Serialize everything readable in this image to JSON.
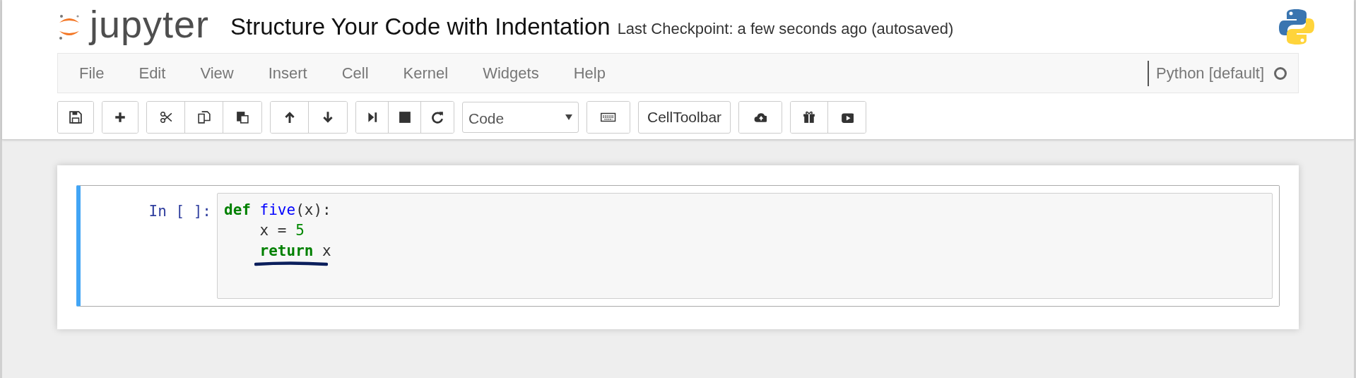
{
  "header": {
    "logo_text": "jupyter",
    "notebook_title": "Structure Your Code with Indentation",
    "checkpoint": "Last Checkpoint: a few seconds ago (autosaved)"
  },
  "menu": [
    "File",
    "Edit",
    "View",
    "Insert",
    "Cell",
    "Kernel",
    "Widgets",
    "Help"
  ],
  "kernel": {
    "name": "Python [default]",
    "busy": false
  },
  "toolbar": {
    "cell_type": "Code",
    "celltoolbar": "CellToolbar"
  },
  "cell": {
    "prompt": "In [ ]:",
    "selected": true,
    "lines": [
      {
        "indented": false,
        "tokens": [
          {
            "kind": "keyword",
            "text": "def"
          },
          {
            "kind": "def",
            "text": "five",
            "space_before": true
          },
          {
            "kind": "plain",
            "text": "(x):"
          }
        ]
      },
      {
        "indented": true,
        "tokens": [
          {
            "kind": "plain",
            "text": "x ="
          },
          {
            "kind": "number",
            "text": "5",
            "space_before": true
          }
        ]
      },
      {
        "indented": true,
        "tokens": [
          {
            "kind": "keyword",
            "text": "return"
          },
          {
            "kind": "plain",
            "text": "x",
            "space_before": true
          }
        ]
      }
    ]
  }
}
